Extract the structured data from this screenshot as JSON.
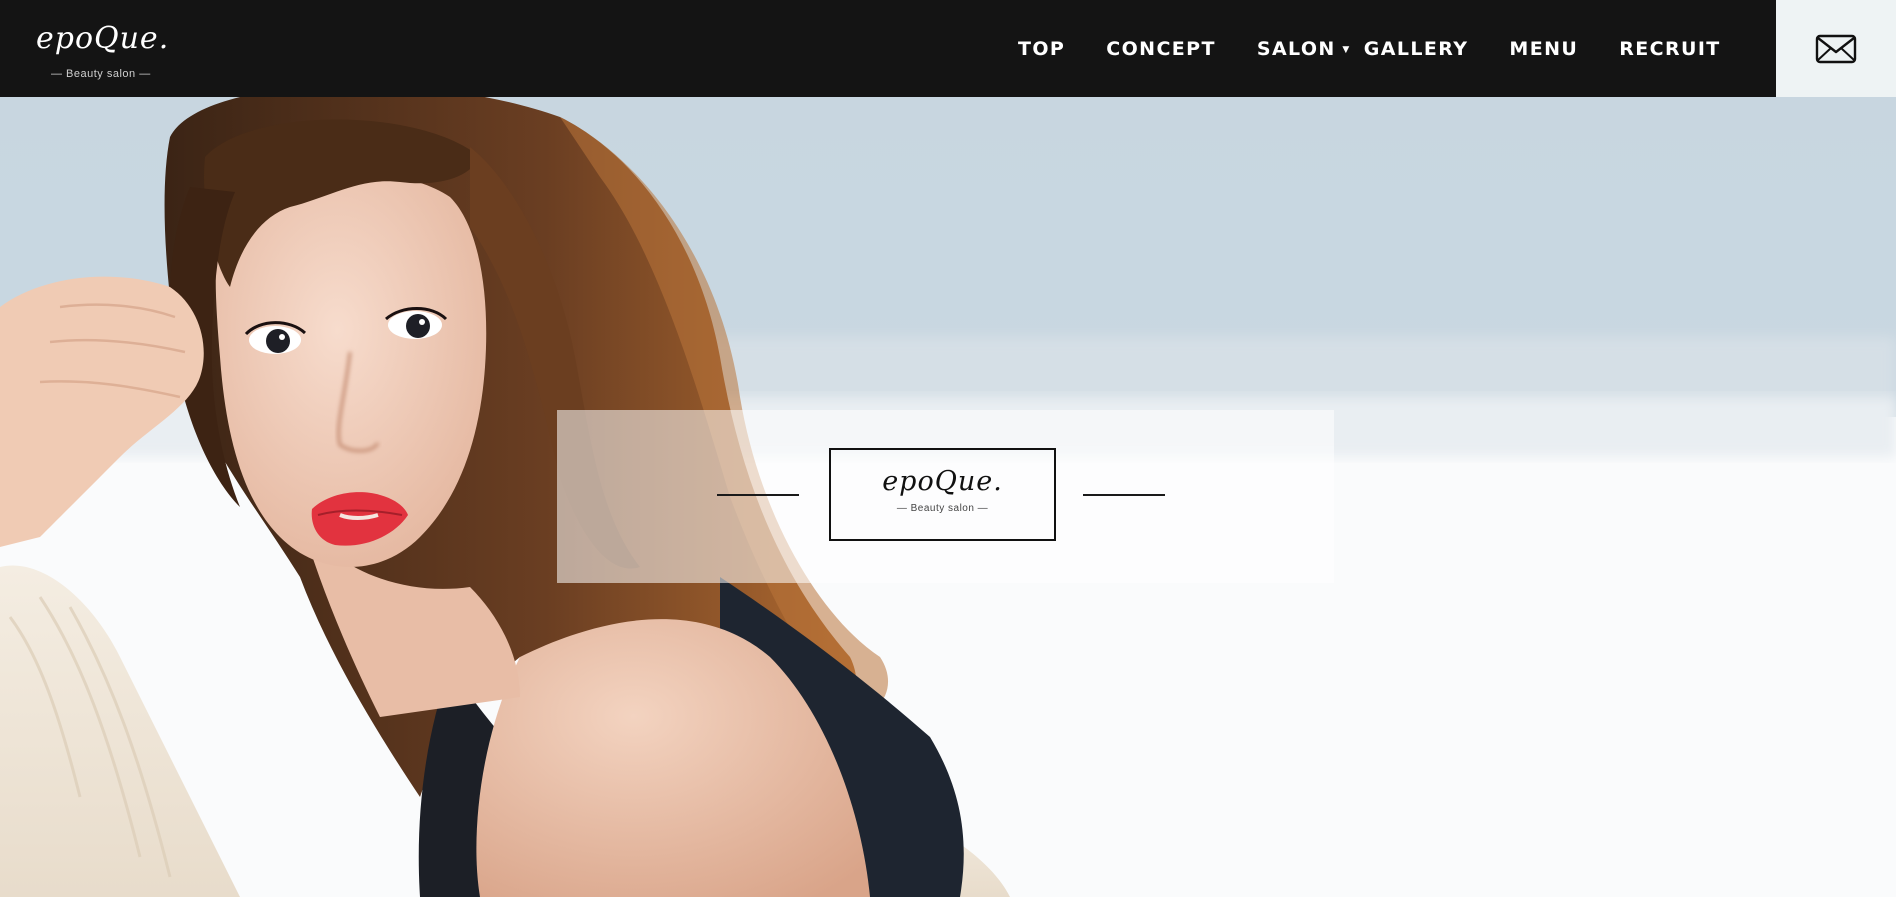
{
  "header": {
    "logo": {
      "word": "epoQue.",
      "subtitle": "— Beauty salon —"
    },
    "nav": [
      {
        "label": "TOP",
        "has_dropdown": false
      },
      {
        "label": "CONCEPT",
        "has_dropdown": false
      },
      {
        "label": "SALON",
        "has_dropdown": true
      },
      {
        "label": "GALLERY",
        "has_dropdown": false
      },
      {
        "label": "MENU",
        "has_dropdown": false
      },
      {
        "label": "RECRUIT",
        "has_dropdown": false
      }
    ],
    "contact_icon": "mail-icon"
  },
  "hero": {
    "brand": {
      "word": "epoQue.",
      "subtitle": "— Beauty salon —"
    },
    "photo": "woman-portrait"
  },
  "colors": {
    "header_bg": "#141414",
    "nav_text": "#ffffff",
    "mail_button_bg": "#eef3f4",
    "brand_text": "#111111"
  }
}
